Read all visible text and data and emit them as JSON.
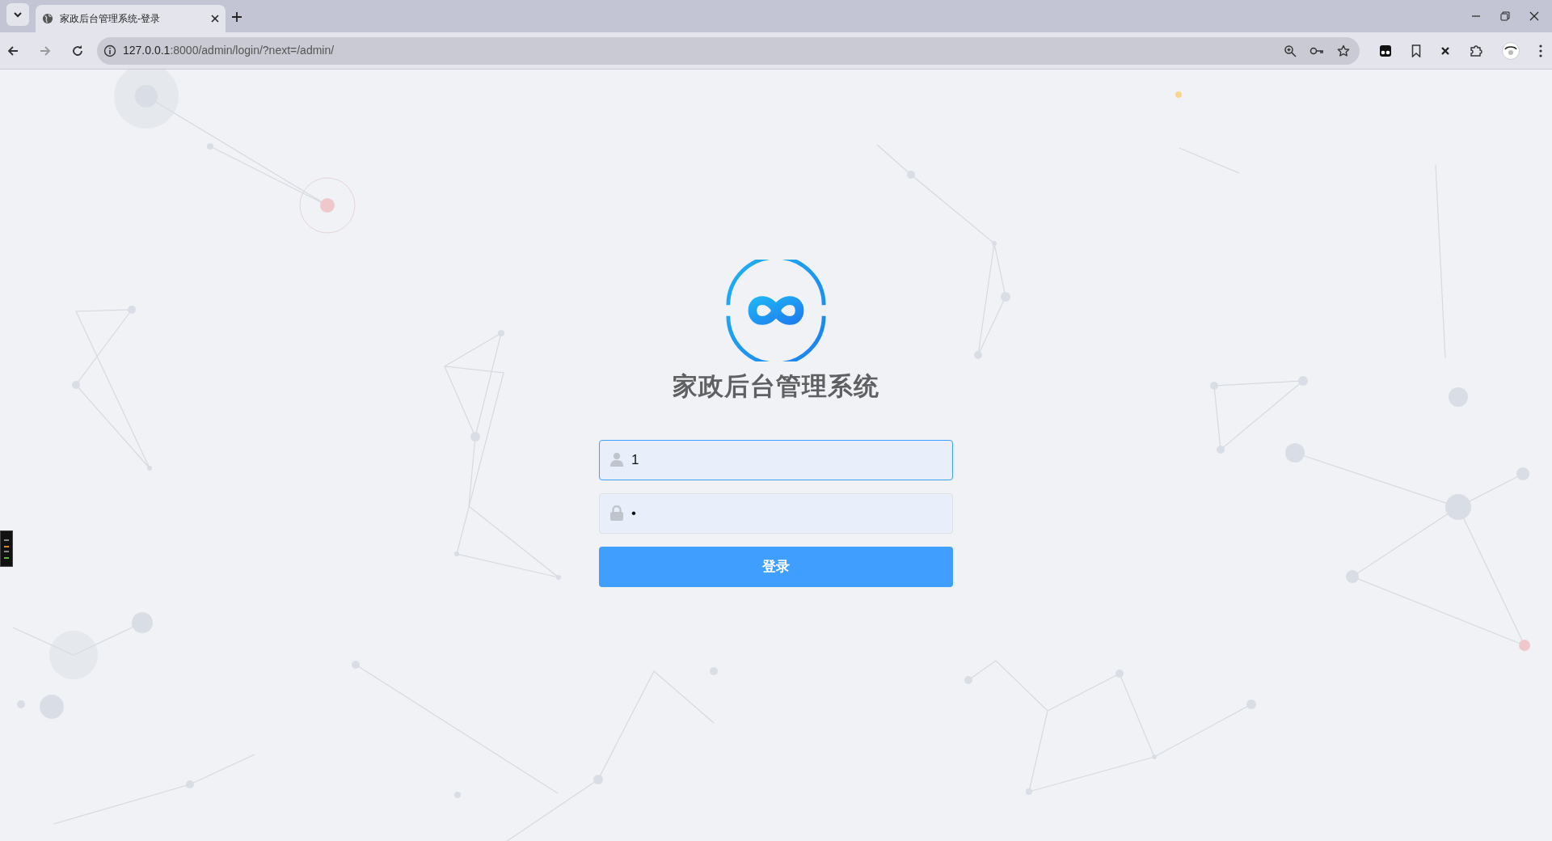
{
  "browser": {
    "tab": {
      "title": "家政后台管理系统-登录"
    },
    "address": {
      "host": "127.0.0.1",
      "rest": ":8000/admin/login/?next=/admin/"
    }
  },
  "login": {
    "title": "家政后台管理系统",
    "fields": [
      {
        "kind": "user",
        "value": "1",
        "focused": true
      },
      {
        "kind": "password",
        "value": "•",
        "focused": false
      }
    ],
    "submit": "登录"
  }
}
